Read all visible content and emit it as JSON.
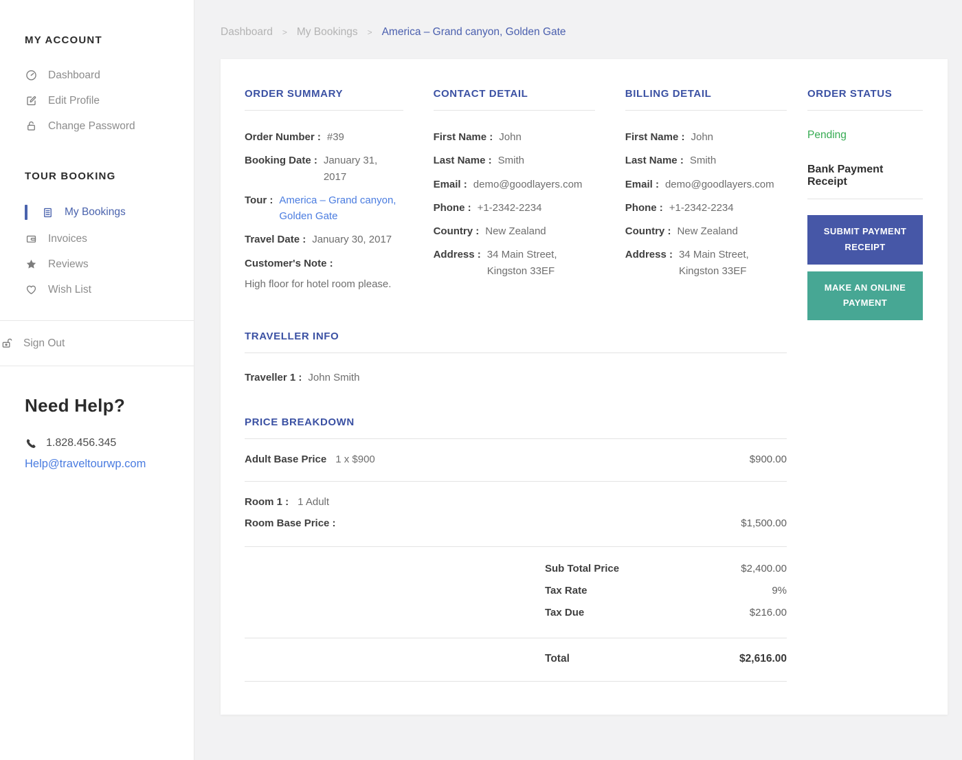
{
  "colors": {
    "accent_indigo": "#3b51a3",
    "active_nav_blue": "#4a63ad",
    "tour_link_blue": "#4a7ce0",
    "pending_green": "#35ab52",
    "submit_button_bg": "#4657a7",
    "online_button_bg": "#47a794"
  },
  "sidebar": {
    "account": {
      "heading": "MY ACCOUNT",
      "items": [
        {
          "label": "Dashboard",
          "icon": "dashboard-icon"
        },
        {
          "label": "Edit Profile",
          "icon": "edit-icon"
        },
        {
          "label": "Change Password",
          "icon": "lock-icon"
        }
      ]
    },
    "booking": {
      "heading": "TOUR BOOKING",
      "items": [
        {
          "label": "My Bookings",
          "icon": "bookings-icon",
          "active": true
        },
        {
          "label": "Invoices",
          "icon": "wallet-icon",
          "active": false
        },
        {
          "label": "Reviews",
          "icon": "star-icon",
          "active": false
        },
        {
          "label": "Wish List",
          "icon": "heart-icon",
          "active": false
        }
      ]
    },
    "signout_label": "Sign Out",
    "help": {
      "heading": "Need Help?",
      "phone": "1.828.456.345",
      "email": "Help@traveltourwp.com"
    }
  },
  "breadcrumb": {
    "separator": ">",
    "items": [
      {
        "label": "Dashboard"
      },
      {
        "label": "My Bookings"
      },
      {
        "label": "America – Grand canyon, Golden Gate"
      }
    ]
  },
  "order_summary": {
    "title": "ORDER SUMMARY",
    "order_number": {
      "label": "Order Number :",
      "value": "#39"
    },
    "booking_date": {
      "label": "Booking Date :",
      "value": "January 31, 2017"
    },
    "tour": {
      "label": "Tour :",
      "line1": "America – Grand canyon,",
      "line2": "Golden Gate"
    },
    "travel_date": {
      "label": "Travel Date :",
      "value": "January 30, 2017"
    },
    "customer_note": {
      "label": "Customer's Note :",
      "value": "High floor for hotel room please."
    }
  },
  "contact_detail": {
    "title": "CONTACT DETAIL",
    "first_name": {
      "label": "First Name :",
      "value": "John"
    },
    "last_name": {
      "label": "Last Name :",
      "value": "Smith"
    },
    "email": {
      "label": "Email :",
      "value": "demo@goodlayers.com"
    },
    "phone": {
      "label": "Phone :",
      "value": "+1-2342-2234"
    },
    "country": {
      "label": "Country :",
      "value": "New Zealand"
    },
    "address": {
      "label": "Address :",
      "line1": "34 Main Street,",
      "line2": "Kingston 33EF"
    }
  },
  "billing_detail": {
    "title": "BILLING DETAIL",
    "first_name": {
      "label": "First Name :",
      "value": "John"
    },
    "last_name": {
      "label": "Last Name :",
      "value": "Smith"
    },
    "email": {
      "label": "Email :",
      "value": "demo@goodlayers.com"
    },
    "phone": {
      "label": "Phone :",
      "value": "+1-2342-2234"
    },
    "country": {
      "label": "Country :",
      "value": "New Zealand"
    },
    "address": {
      "label": "Address :",
      "line1": "34 Main Street,",
      "line2": "Kingston 33EF"
    }
  },
  "order_status": {
    "title": "ORDER STATUS",
    "status": "Pending",
    "receipt_heading": "Bank Payment Receipt",
    "submit_button": "SUBMIT PAYMENT RECEIPT",
    "online_button": "MAKE AN ONLINE PAYMENT"
  },
  "traveller_info": {
    "title": "TRAVELLER INFO",
    "traveller1": {
      "label": "Traveller 1 :",
      "value": "John Smith"
    }
  },
  "price_breakdown": {
    "title": "PRICE BREAKDOWN",
    "adult_base": {
      "label": "Adult Base Price",
      "qty": "1 x $900",
      "amount": "$900.00"
    },
    "room1": {
      "label": "Room 1 :",
      "value": "1 Adult"
    },
    "room_base": {
      "label": "Room Base Price :",
      "amount": "$1,500.00"
    },
    "sub_total": {
      "label": "Sub Total Price",
      "value": "$2,400.00"
    },
    "tax_rate": {
      "label": "Tax Rate",
      "value": "9%"
    },
    "tax_due": {
      "label": "Tax Due",
      "value": "$216.00"
    },
    "total": {
      "label": "Total",
      "value": "$2,616.00"
    }
  }
}
